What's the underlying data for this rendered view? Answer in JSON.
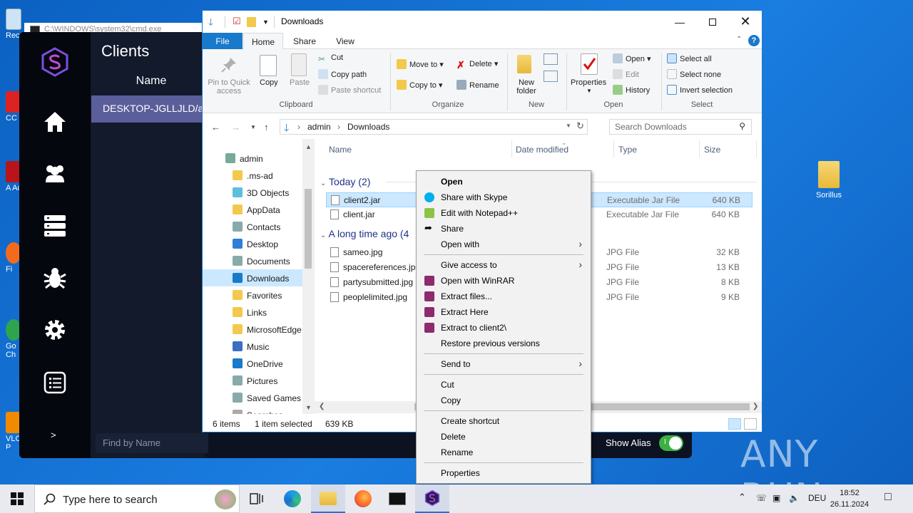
{
  "desktop": {
    "right_icon_label": "Sorillus",
    "partial_labels": [
      "Recy",
      "CC",
      "A Ac",
      "Fi",
      "Go Ch",
      "VLC P"
    ]
  },
  "cmd": {
    "title": "C:\\WINDOWS\\system32\\cmd.exe"
  },
  "rat": {
    "header": "Clients",
    "column_name": "Name",
    "selected_client": "DESKTOP-JGLLJLD/a...",
    "find_placeholder": "Find by Name",
    "show_alias": "Show Alias",
    "toggle_on": "I",
    "expand": ">"
  },
  "explorer": {
    "title": "Downloads",
    "tabs": {
      "file": "File",
      "home": "Home",
      "share": "Share",
      "view": "View"
    },
    "ribbon": {
      "pin": "Pin to Quick access",
      "copy": "Copy",
      "paste": "Paste",
      "cut": "Cut",
      "copy_path": "Copy path",
      "paste_shortcut": "Paste shortcut",
      "clipboard": "Clipboard",
      "move_to": "Move to",
      "copy_to": "Copy to",
      "delete": "Delete",
      "rename": "Rename",
      "organize": "Organize",
      "new_folder": "New folder",
      "new": "New",
      "properties": "Properties",
      "open": "Open",
      "edit": "Edit",
      "history": "History",
      "open_group": "Open",
      "select_all": "Select all",
      "select_none": "Select none",
      "invert_selection": "Invert selection",
      "select": "Select"
    },
    "address": {
      "seg1": "admin",
      "seg2": "Downloads"
    },
    "search_placeholder": "Search Downloads",
    "nav": [
      "admin",
      ".ms-ad",
      "3D Objects",
      "AppData",
      "Contacts",
      "Desktop",
      "Documents",
      "Downloads",
      "Favorites",
      "Links",
      "MicrosoftEdge",
      "Music",
      "OneDrive",
      "Pictures",
      "Saved Games",
      "Searches"
    ],
    "columns": {
      "name": "Name",
      "date": "Date modified",
      "type": "Type",
      "size": "Size"
    },
    "groups": {
      "today": "Today (2)",
      "longago": "A long time ago (4"
    },
    "files_today": [
      {
        "name": "client2.jar",
        "type": "Executable Jar File",
        "size": "640 KB"
      },
      {
        "name": "client.jar",
        "type": "Executable Jar File",
        "size": "640 KB"
      }
    ],
    "files_old": [
      {
        "name": "sameo.jpg",
        "type": "JPG File",
        "size": "32 KB"
      },
      {
        "name": "spacereferences.jpg",
        "type": "JPG File",
        "size": "13 KB"
      },
      {
        "name": "partysubmitted.jpg",
        "type": "JPG File",
        "size": "8 KB"
      },
      {
        "name": "peoplelimited.jpg",
        "type": "JPG File",
        "size": "9 KB"
      }
    ],
    "status": {
      "items": "6 items",
      "selected": "1 item selected",
      "size": "639 KB"
    }
  },
  "context_menu": {
    "open": "Open",
    "skype": "Share with Skype",
    "notepad": "Edit with Notepad++",
    "share": "Share",
    "open_with": "Open with",
    "give_access": "Give access to",
    "winrar_open": "Open with WinRAR",
    "extract_files": "Extract files...",
    "extract_here": "Extract Here",
    "extract_to": "Extract to client2\\",
    "restore": "Restore previous versions",
    "send_to": "Send to",
    "cut": "Cut",
    "copy": "Copy",
    "create_shortcut": "Create shortcut",
    "delete": "Delete",
    "rename": "Rename",
    "properties": "Properties"
  },
  "taskbar": {
    "search_placeholder": "Type here to search",
    "lang": "DEU",
    "time": "18:52",
    "date": "26.11.2024"
  },
  "watermark": "ANY RUN",
  "colors": {
    "explorer_accent": "#1979ca",
    "selection": "#cce8ff",
    "rat_selected": "#5a5e9a",
    "toggle_on": "#3cb043"
  }
}
